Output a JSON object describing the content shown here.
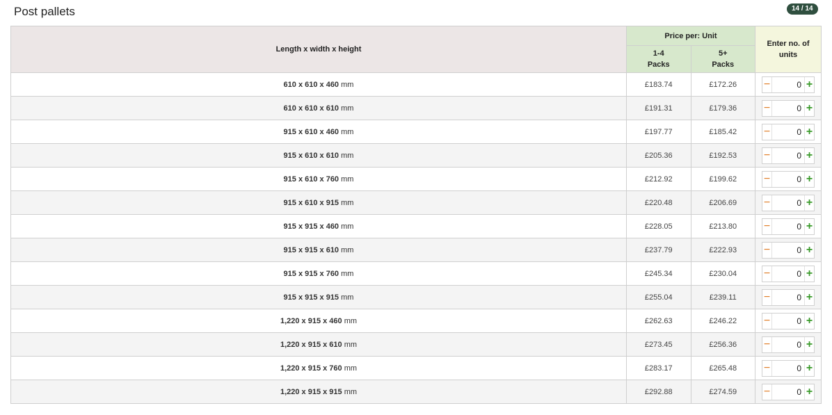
{
  "page": {
    "title": "Post pallets",
    "badge": "14 / 14"
  },
  "table": {
    "headers": {
      "dimensions": "Length x width x height",
      "price_group": "Price per:  Unit",
      "price_tier1_line1": "1-4",
      "price_tier1_line2": "Packs",
      "price_tier2_line1": "5+",
      "price_tier2_line2": "Packs",
      "units_line1": "Enter no. of",
      "units_line2": "units"
    },
    "unit_label": "mm",
    "rows": [
      {
        "dims": "610 x 610 x 460",
        "price_1_4": "£183.74",
        "price_5": "£172.26",
        "qty": "0"
      },
      {
        "dims": "610 x 610 x 610",
        "price_1_4": "£191.31",
        "price_5": "£179.36",
        "qty": "0"
      },
      {
        "dims": "915 x 610 x 460",
        "price_1_4": "£197.77",
        "price_5": "£185.42",
        "qty": "0"
      },
      {
        "dims": "915 x 610 x 610",
        "price_1_4": "£205.36",
        "price_5": "£192.53",
        "qty": "0"
      },
      {
        "dims": "915 x 610 x 760",
        "price_1_4": "£212.92",
        "price_5": "£199.62",
        "qty": "0"
      },
      {
        "dims": "915 x 610 x 915",
        "price_1_4": "£220.48",
        "price_5": "£206.69",
        "qty": "0"
      },
      {
        "dims": "915 x 915 x 460",
        "price_1_4": "£228.05",
        "price_5": "£213.80",
        "qty": "0"
      },
      {
        "dims": "915 x 915 x 610",
        "price_1_4": "£237.79",
        "price_5": "£222.93",
        "qty": "0"
      },
      {
        "dims": "915 x 915 x 760",
        "price_1_4": "£245.34",
        "price_5": "£230.04",
        "qty": "0"
      },
      {
        "dims": "915 x 915 x 915",
        "price_1_4": "£255.04",
        "price_5": "£239.11",
        "qty": "0"
      },
      {
        "dims": "1,220 x 915 x 460",
        "price_1_4": "£262.63",
        "price_5": "£246.22",
        "qty": "0"
      },
      {
        "dims": "1,220 x 915 x 610",
        "price_1_4": "£273.45",
        "price_5": "£256.36",
        "qty": "0"
      },
      {
        "dims": "1,220 x 915 x 760",
        "price_1_4": "£283.17",
        "price_5": "£265.48",
        "qty": "0"
      },
      {
        "dims": "1,220 x 915 x 915",
        "price_1_4": "£292.88",
        "price_5": "£274.59",
        "qty": "0"
      }
    ],
    "stepper": {
      "minus_icon": "minus-icon",
      "plus_icon": "plus-icon",
      "minus_glyph": "−",
      "plus_glyph": "+"
    }
  },
  "colors": {
    "badge_bg": "#2f4f3f",
    "header_dims_bg": "#ece6e6",
    "header_price_bg": "#d7e8cc",
    "header_units_bg": "#f4f6dd",
    "minus_color": "#e07b24",
    "plus_color": "#3a9a2a"
  }
}
